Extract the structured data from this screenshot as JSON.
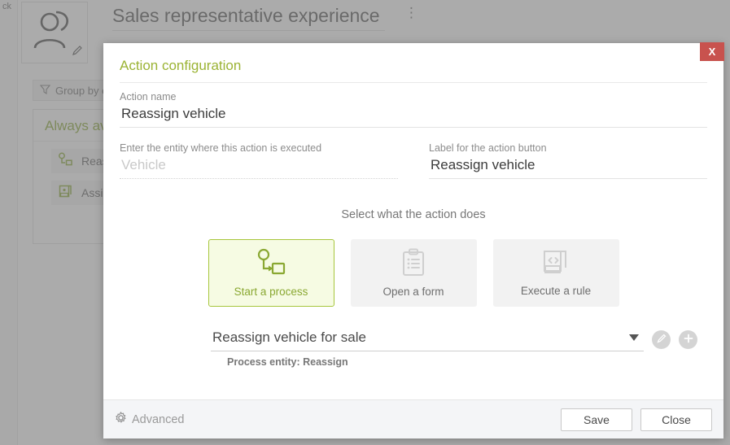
{
  "background": {
    "back_label": "ck",
    "page_title": "Sales representative experience",
    "kebab_icon": "more-vertical-icon",
    "avatar_icon": "users-avatar-icon",
    "edit_pencil_icon": "pencil-icon",
    "groupby": {
      "icon": "filter-icon",
      "label": "Group by e"
    },
    "panel": {
      "title": "Always av",
      "items": [
        {
          "icon": "process-icon",
          "label": "Reass"
        },
        {
          "icon": "rule-icon",
          "label": "Assig"
        }
      ]
    }
  },
  "modal": {
    "heading": "Action configuration",
    "close_label": "X",
    "fields": {
      "action_name_label": "Action name",
      "action_name_value": "Reassign vehicle",
      "entity_label": "Enter the entity where this action is executed",
      "entity_placeholder": "Vehicle",
      "button_label_label": "Label for the action button",
      "button_label_value": "Reassign vehicle"
    },
    "select_prompt": "Select what the action does",
    "cards": [
      {
        "id": "start-a-process",
        "icon": "process-flow-icon",
        "label": "Start a process",
        "selected": true
      },
      {
        "id": "open-a-form",
        "icon": "clipboard-form-icon",
        "label": "Open a form",
        "selected": false
      },
      {
        "id": "execute-a-rule",
        "icon": "rule-code-icon",
        "label": "Execute a rule",
        "selected": false
      }
    ],
    "process_select": {
      "value": "Reassign vehicle for sale",
      "caret_icon": "chevron-down-icon",
      "edit_icon": "pencil-icon",
      "add_icon": "plus-icon"
    },
    "process_entity": "Process entity: Reassign",
    "footer": {
      "advanced_icon": "gear-icon",
      "advanced_label": "Advanced",
      "save_label": "Save",
      "close_label": "Close"
    }
  },
  "colors": {
    "accent_green": "#9bb334",
    "selected_border": "#a7c63c",
    "selected_fill": "#f6fbe3",
    "close_red": "#c8524e",
    "footer_bg": "#f4f5f7",
    "card_bg": "#f2f2f2"
  }
}
